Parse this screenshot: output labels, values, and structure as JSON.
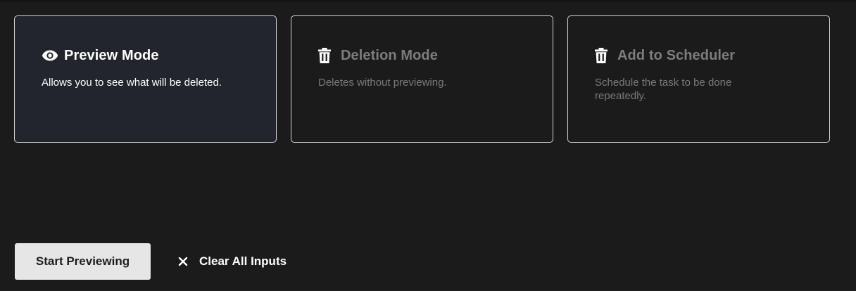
{
  "modes": [
    {
      "title": "Preview Mode",
      "description": "Allows you to see what will be deleted.",
      "icon": "eye-icon",
      "selected": true
    },
    {
      "title": "Deletion Mode",
      "description": "Deletes without previewing.",
      "icon": "trash-icon",
      "selected": false
    },
    {
      "title": "Add to Scheduler",
      "description": "Schedule the task to be done repeatedly.",
      "icon": "trash-icon",
      "selected": false
    }
  ],
  "actions": {
    "primary_label": "Start Previewing",
    "clear_label": "Clear All Inputs",
    "clear_icon": "close-icon"
  },
  "colors": {
    "background": "#1b1b1c",
    "selected_card": "#22252d",
    "card_border": "#d6d6d6",
    "muted_text": "#7a7a7a",
    "button_bg": "#e6e6e6"
  }
}
